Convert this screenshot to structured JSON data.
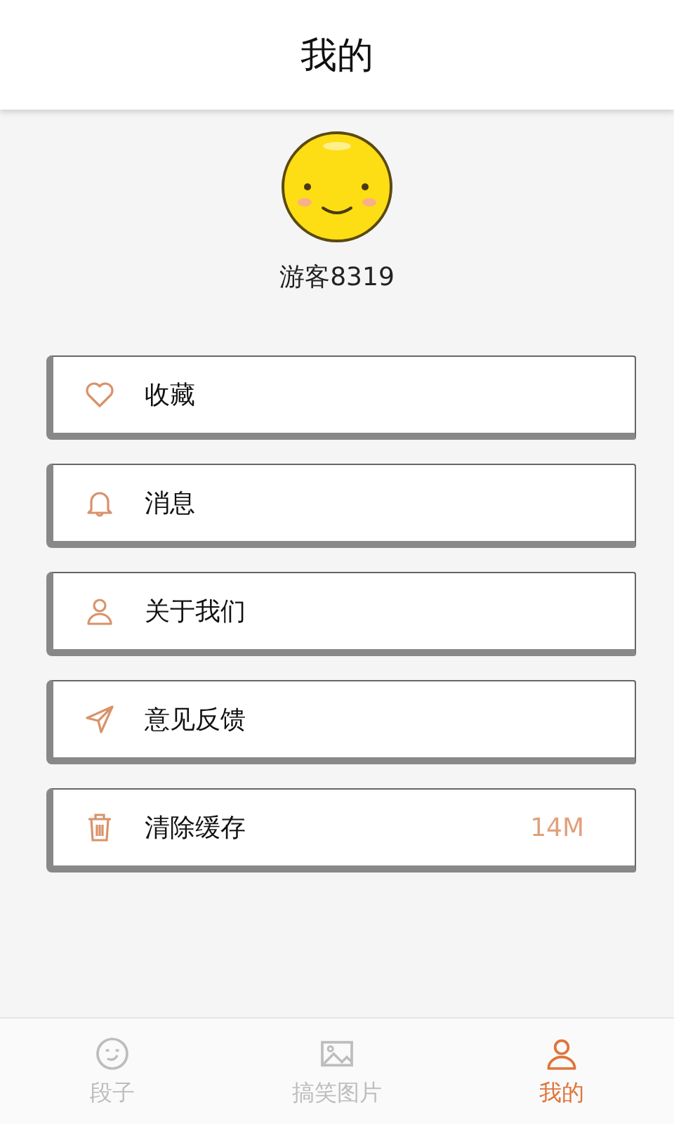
{
  "header": {
    "title": "我的"
  },
  "profile": {
    "username": "游客8319"
  },
  "menu": [
    {
      "kind": "heart",
      "label": "收藏"
    },
    {
      "kind": "bell",
      "label": "消息"
    },
    {
      "kind": "person",
      "label": "关于我们"
    },
    {
      "kind": "send",
      "label": "意见反馈"
    },
    {
      "kind": "trash",
      "label": "清除缓存",
      "value": "14M"
    }
  ],
  "tabs": [
    {
      "kind": "face",
      "label": "段子",
      "selected": false
    },
    {
      "kind": "image",
      "label": "搞笑图片",
      "selected": false
    },
    {
      "kind": "person",
      "label": "我的",
      "selected": true
    }
  ]
}
